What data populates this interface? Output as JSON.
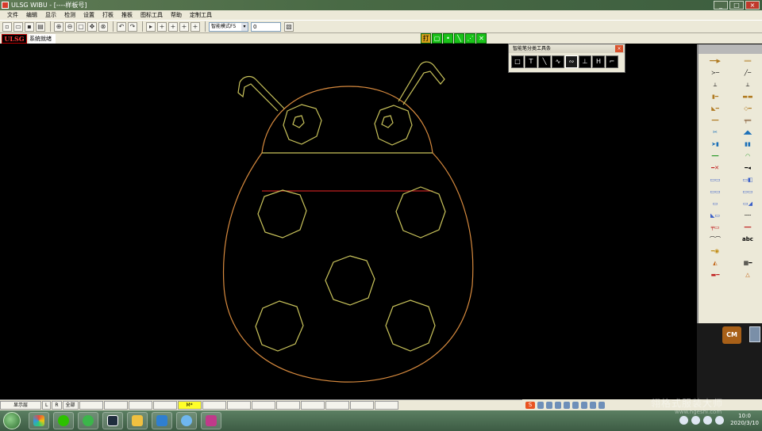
{
  "window": {
    "title": "ULSG WIBU - [----样板号]"
  },
  "menu": [
    "文件",
    "编辑",
    "显示",
    "检测",
    "设置",
    "打板",
    "推板",
    "图标工具",
    "帮助",
    "定制工具"
  ],
  "toolbar": {
    "mode_select": "智能模式F5",
    "value_field": "0"
  },
  "status": {
    "logo": "ULSG",
    "message": "系统就绪"
  },
  "mode_buttons": [
    "打"
  ],
  "float_panel": {
    "title": "智能笔分类工具条",
    "tools": [
      "rect-tool",
      "text-tool",
      "line-tool",
      "curve-tool",
      "smart-curve-tool",
      "measure-tool",
      "H",
      "corner-tool"
    ]
  },
  "right_panel": {
    "label_tool": "abc",
    "cm_button": "CM"
  },
  "bottom": {
    "layer_label": "显示层",
    "l_btn": "L",
    "r_btn": "R",
    "all_btn": "全部",
    "active_cell": "M*"
  },
  "taskbar": {
    "tray_brand": "S",
    "clock_time": "10:0",
    "clock_date": "2020/3/10"
  },
  "watermark": {
    "main": "翎格式服装大师",
    "sub": "www.hgeshi.com"
  },
  "colors": {
    "canvas": "#000000",
    "pattern_line": "#d78a3e",
    "body_outline": "#c9c35b",
    "red_line": "#c02020",
    "active_green": "#19c219"
  }
}
